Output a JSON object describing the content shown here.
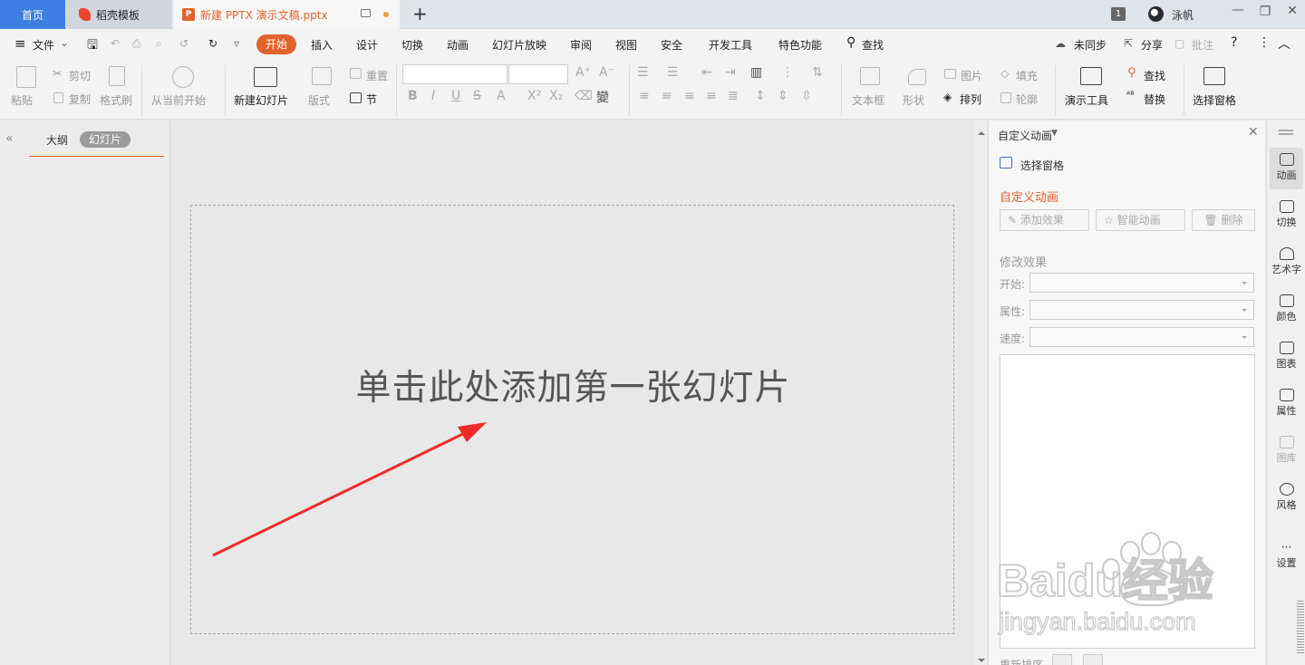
{
  "titlebar": {
    "tabs": [
      {
        "label": "首页"
      },
      {
        "label": "稻壳模板"
      },
      {
        "label": "新建 PPTX 演示文稿.pptx"
      }
    ],
    "new_tab": "+",
    "badge": "1",
    "username": "泳帆"
  },
  "menubar": {
    "file": "文件",
    "items": [
      "开始",
      "插入",
      "设计",
      "切换",
      "动画",
      "幻灯片放映",
      "审阅",
      "视图",
      "安全",
      "开发工具",
      "特色功能"
    ],
    "search": "查找",
    "sync": "未同步",
    "share": "分享",
    "comment": "批注"
  },
  "toolbar": {
    "paste": "粘贴",
    "cut": "剪切",
    "copy": "复制",
    "format_painter": "格式刷",
    "from_current": "从当前开始",
    "new_slide": "新建幻灯片",
    "layout": "版式",
    "reset": "重置",
    "section": "节",
    "textbox": "文本框",
    "shape": "形状",
    "picture": "图片",
    "fill": "填充",
    "arrange": "排列",
    "outline": "轮廓",
    "present_tools": "演示工具",
    "find": "查找",
    "replace": "替换",
    "selection_pane": "选择窗格"
  },
  "left_panel": {
    "tab_outline": "大纲",
    "tab_slides": "幻灯片"
  },
  "slide": {
    "placeholder": "单击此处添加第一张幻灯片"
  },
  "right_panel": {
    "header": "自定义动画",
    "selection_pane": "选择窗格",
    "section_title": "自定义动画",
    "add_effect": "添加效果",
    "smart_animation": "智能动画",
    "delete": "删除",
    "modify_title": "修改效果",
    "start_label": "开始:",
    "property_label": "属性:",
    "speed_label": "速度:",
    "reorder": "重新排序"
  },
  "right_sidebar": {
    "items": [
      "动画",
      "切换",
      "艺术字",
      "颜色",
      "图表",
      "属性",
      "图库",
      "风格",
      "设置"
    ]
  },
  "watermark": {
    "brand": "Baidu经验",
    "url": "jingyan.baidu.com"
  },
  "colors": {
    "accent": "#e2622c",
    "home_tab": "#3d7fe3",
    "arrow": "#ee2b2b"
  }
}
